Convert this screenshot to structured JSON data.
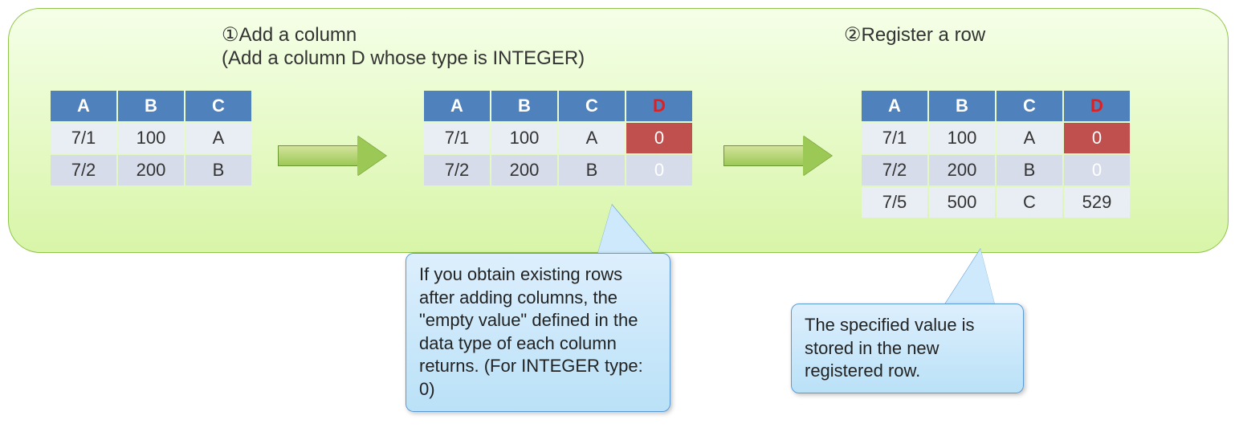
{
  "step1": {
    "title": "①Add a column",
    "subtitle": "(Add a column D whose type is INTEGER)"
  },
  "step2": {
    "title": "②Register a row"
  },
  "table1": {
    "headers": [
      "A",
      "B",
      "C"
    ],
    "rows": [
      [
        "7/1",
        "100",
        "A"
      ],
      [
        "7/2",
        "200",
        "B"
      ]
    ]
  },
  "table2": {
    "headers": [
      "A",
      "B",
      "C",
      "D"
    ],
    "rows": [
      {
        "cells": [
          "7/1",
          "100",
          "A",
          "0"
        ],
        "empty_col": 3
      },
      {
        "cells": [
          "7/2",
          "200",
          "B",
          "0"
        ],
        "empty_col": 3
      }
    ]
  },
  "table3": {
    "headers": [
      "A",
      "B",
      "C",
      "D"
    ],
    "rows": [
      {
        "cells": [
          "7/1",
          "100",
          "A",
          "0"
        ],
        "empty_col": 3
      },
      {
        "cells": [
          "7/2",
          "200",
          "B",
          "0"
        ],
        "empty_col": 3
      },
      {
        "cells": [
          "7/5",
          "500",
          "C",
          "529"
        ],
        "empty_col": null
      }
    ]
  },
  "callout1": {
    "text": "If you obtain existing rows after adding columns, the \"empty value\" defined in the data type of each column returns.\n(For INTEGER type: 0)"
  },
  "callout2": {
    "text": "The specified value is stored in the new registered row."
  }
}
